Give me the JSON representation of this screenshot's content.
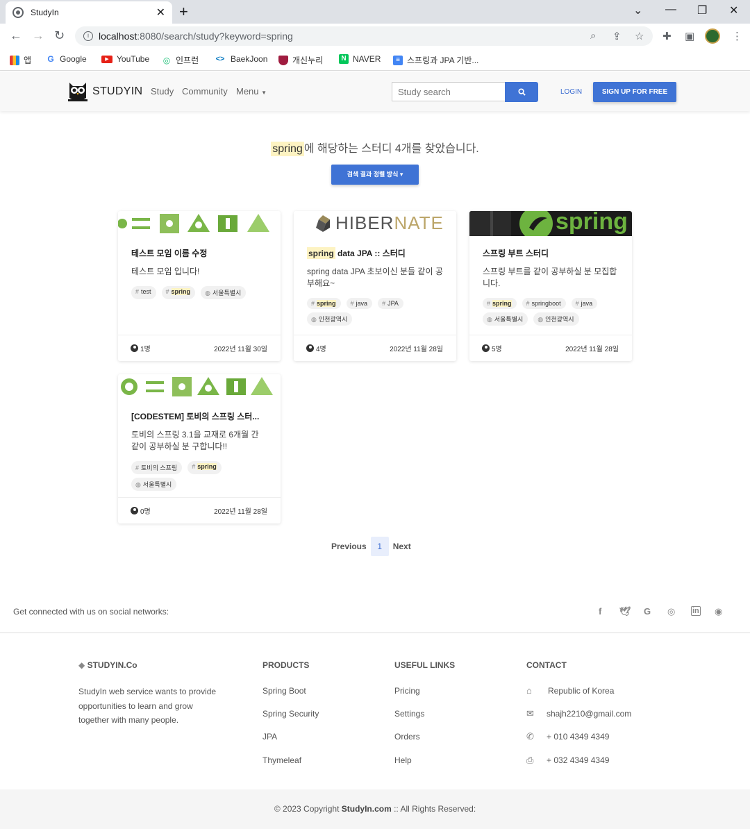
{
  "browser": {
    "tab_title": "StudyIn",
    "url_host": "localhost",
    "url_rest": ":8080/search/study?keyword=spring",
    "bookmarks": [
      "앱",
      "Google",
      "YouTube",
      "인프런",
      "BaekJoon",
      "개신누리",
      "NAVER",
      "스프링과 JPA 기반..."
    ]
  },
  "nav": {
    "brand": "STUDYIN",
    "links": [
      "Study",
      "Community",
      "Menu"
    ],
    "search_placeholder": "Study search",
    "login": "LOGIN",
    "signup": "SIGN UP FOR FREE"
  },
  "result": {
    "keyword": "spring",
    "text": "에 해당하는 스터디 4개를 찾았습니다.",
    "sort_button": "검색 결과 정렬 방식"
  },
  "cards": [
    {
      "title": "테스트 모임 이름 수정",
      "desc": "테스트 모임 입니다!",
      "tags": [
        "test",
        "spring"
      ],
      "zones": [
        "서울특별시"
      ],
      "members": "1명",
      "date": "2022년 11월 30일"
    },
    {
      "title_kw": "spring",
      "title_rest": " data JPA :: 스터디",
      "desc": "spring data JPA 초보이신 분들 같이 공부해요~",
      "tags": [
        "spring",
        "java",
        "JPA"
      ],
      "zones": [
        "인천광역시"
      ],
      "members": "4명",
      "date": "2022년 11월 28일"
    },
    {
      "title": "스프링 부트 스터디",
      "desc": "스프링 부트를 같이 공부하실 분 모집합니다.",
      "tags": [
        "spring",
        "springboot",
        "java"
      ],
      "zones": [
        "서울특별시",
        "인천광역시"
      ],
      "members": "5명",
      "date": "2022년 11월 28일"
    },
    {
      "title": "[CODESTEM] 토비의 스프링 스터...",
      "desc": "토비의 스프링 3.1을 교재로 6개월 간 같이 공부하실 분 구합니다!!",
      "tags": [
        "토비의 스프링",
        "spring"
      ],
      "zones": [
        "서울특별시"
      ],
      "members": "0명",
      "date": "2022년 11월 28일"
    }
  ],
  "card_images": {
    "hibernate_a": "HIBER",
    "hibernate_b": "NATE",
    "spring": "spring"
  },
  "pagination": {
    "prev": "Previous",
    "page": "1",
    "next": "Next"
  },
  "footer": {
    "social_text": "Get connected with us on social networks:",
    "brand": "STUDYIN.Co",
    "about": "StudyIn web service wants to provide opportunities to learn and grow together with many people.",
    "products_title": "PRODUCTS",
    "products": [
      "Spring Boot",
      "Spring Security",
      "JPA",
      "Thymeleaf"
    ],
    "links_title": "USEFUL LINKS",
    "links": [
      "Pricing",
      "Settings",
      "Orders",
      "Help"
    ],
    "contact_title": "CONTACT",
    "contact": [
      "Republic of Korea",
      "shajh2210@gmail.com",
      "+ 010 4349 4349",
      "+ 032 4349 4349"
    ],
    "copy_pre": "© 2023 Copyright ",
    "copy_brand": "StudyIn.com",
    "copy_post": " :: All Rights Reserved:"
  },
  "colors": {
    "primary": "#3f73d5",
    "highlight": "#fdf3c2",
    "spring_green": "#6db33f"
  }
}
